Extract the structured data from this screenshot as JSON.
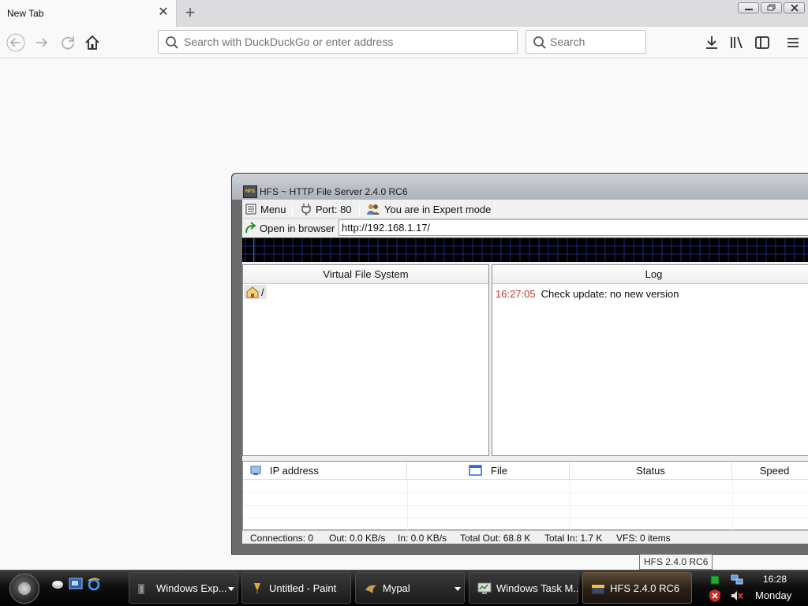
{
  "browser": {
    "tab": {
      "title": "New Tab"
    },
    "urlbar": {
      "placeholder": "Search with DuckDuckGo or enter address",
      "value": ""
    },
    "searchbar": {
      "placeholder": "Search",
      "value": ""
    }
  },
  "hfs": {
    "window_title": "HFS ~ HTTP File Server 2.4.0 RC6",
    "logo_text": "HFS",
    "toolbar": {
      "menu_label": "Menu",
      "port_label": "Port: 80",
      "mode_label": "You are in Expert mode"
    },
    "open_in_browser_label": "Open in browser",
    "url_value": "http://192.168.1.17/",
    "vfs": {
      "header": "Virtual File System",
      "root_label": "/"
    },
    "log": {
      "header": "Log",
      "entries": [
        {
          "time": "16:27:05",
          "message": "Check update: no new version"
        }
      ]
    },
    "connections": {
      "columns": [
        "IP address",
        "File",
        "Status",
        "Speed"
      ]
    },
    "statusbar": {
      "connections": "Connections: 0",
      "out": "Out: 0.0 KB/s",
      "in": "In: 0.0 KB/s",
      "total_out": "Total Out: 68.8 K",
      "total_in": "Total In: 1.7 K",
      "vfs": "VFS: 0 items"
    }
  },
  "taskbar": {
    "tooltip": "HFS 2.4.0 RC6",
    "tasks": [
      {
        "label": "Windows Exp...",
        "icon": "folder-icon"
      },
      {
        "label": "Untitled - Paint",
        "icon": "paint-icon"
      },
      {
        "label": "Mypal",
        "icon": "mypal-icon"
      },
      {
        "label": "Windows Task M...",
        "icon": "task-manager-icon"
      },
      {
        "label": "HFS 2.4.0 RC6",
        "icon": "hfs-icon"
      }
    ],
    "clock": {
      "time": "16:28",
      "day": "Monday"
    }
  }
}
